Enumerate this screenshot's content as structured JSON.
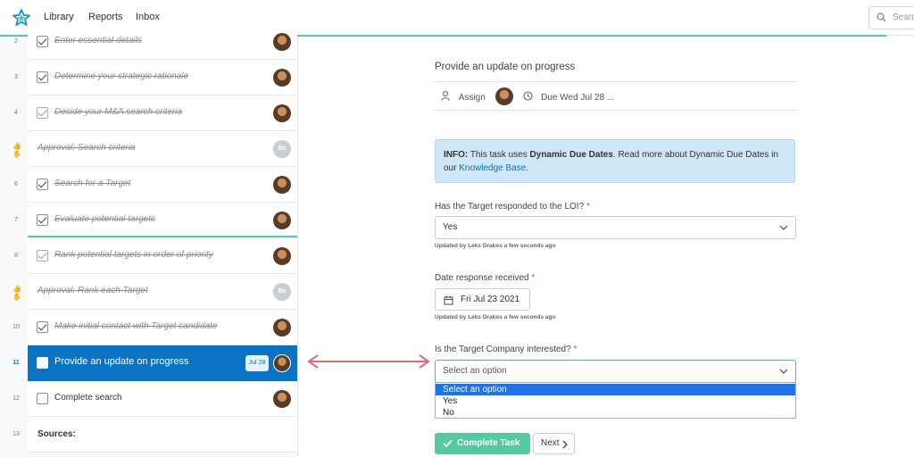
{
  "nav": {
    "links": [
      "Library",
      "Reports",
      "Inbox"
    ],
    "search_placeholder": "Search"
  },
  "tasks": [
    {
      "num": "2",
      "label": "Enter essential details",
      "state": "done"
    },
    {
      "num": "3",
      "label": "Determine your strategic rationale",
      "state": "done"
    },
    {
      "num": "4",
      "label": "Decide your M&A search criteria",
      "state": "done-light"
    },
    {
      "num": "",
      "label": "Approval: Search criteria",
      "state": "approval",
      "avatar": "Be"
    },
    {
      "num": "6",
      "label": "Search for a Target",
      "state": "done"
    },
    {
      "num": "7",
      "label": "Evaluate potential targets",
      "state": "done"
    },
    {
      "num": "8",
      "label": "Rank potential targets in order of priority",
      "state": "done-light"
    },
    {
      "num": "",
      "label": "Approval: Rank each Target",
      "state": "approval",
      "avatar": "Be"
    },
    {
      "num": "10",
      "label": "Make initial contact with Target candidate",
      "state": "done"
    },
    {
      "num": "11",
      "label": "Provide an update on progress",
      "state": "active",
      "due": "Jul 28"
    },
    {
      "num": "12",
      "label": "Complete search",
      "state": "todo"
    },
    {
      "num": "13",
      "label": "Sources:",
      "state": "heading"
    }
  ],
  "task": {
    "title": "Provide an update on progress",
    "assign_label": "Assign",
    "due_label": "Due Wed Jul 28 ...",
    "info": {
      "prefix": "INFO:",
      "text1": "This task uses ",
      "bold": "Dynamic Due Dates",
      "text2": ". Read more about Dynamic Due Dates in our ",
      "link": "Knowledge Base",
      "text3": "."
    },
    "fields": {
      "q1_label": "Has the Target responded to the LOI?",
      "q1_value": "Yes",
      "q1_updated": "Updated by Leks Drakos a few seconds ago",
      "q2_label": "Date response received",
      "q2_value": "Fri Jul 23 2021",
      "q2_updated": "Updated by Leks Drakos a few seconds ago",
      "q3_label": "Is the Target Company interested?",
      "q3_value": "Select an option",
      "q3_options": [
        "Select an option",
        "Yes",
        "No"
      ],
      "required_mark": "*"
    },
    "complete_label": "Complete Task",
    "next_label": "Next"
  },
  "colors": {
    "accent_green": "#56c9a3",
    "active_blue": "#0a73c4",
    "option_highlight": "#1e73e8",
    "annotation_arrow": "#e06b75"
  }
}
